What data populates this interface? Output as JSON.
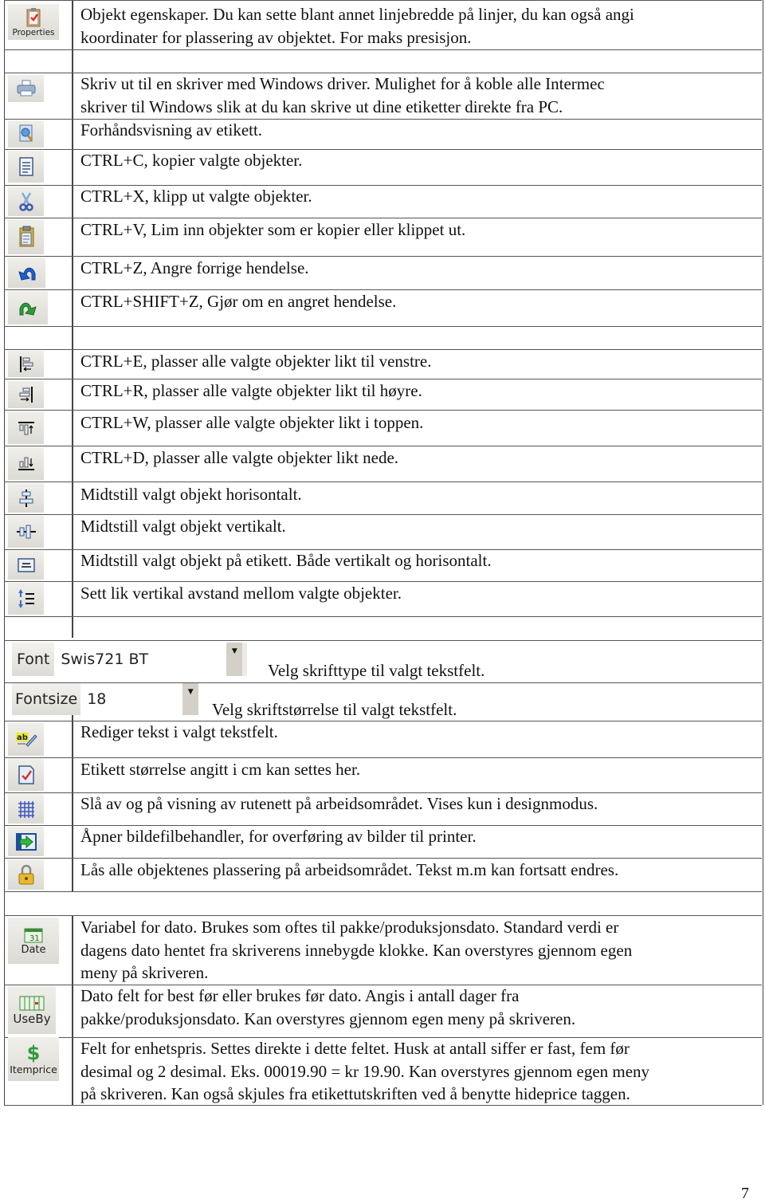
{
  "rows": {
    "properties": {
      "button_label": "Properties",
      "text": [
        "Objekt egenskaper. Du kan sette blant annet linjebredde på linjer, du kan også angi",
        "koordinater for plassering av objektet. For maks presisjon."
      ]
    },
    "print": {
      "text": [
        "Skriv ut til en skriver med Windows driver. Mulighet for å koble alle Intermec",
        "skriver til Windows slik at du kan skrive ut dine etiketter direkte fra PC."
      ]
    },
    "preview": {
      "text": "Forhåndsvisning av etikett."
    },
    "copy": {
      "text": "CTRL+C, kopier valgte objekter."
    },
    "cut": {
      "text": "CTRL+X, klipp ut valgte objekter."
    },
    "paste": {
      "text": "CTRL+V, Lim inn objekter som er kopier eller klippet ut."
    },
    "undo": {
      "text": "CTRL+Z, Angre forrige hendelse."
    },
    "redo": {
      "text": "CTRL+SHIFT+Z, Gjør om en angret hendelse."
    },
    "align_left": {
      "text": "CTRL+E, plasser alle valgte objekter likt til venstre."
    },
    "align_right": {
      "text": "CTRL+R, plasser alle valgte objekter likt til høyre."
    },
    "align_top": {
      "text": "CTRL+W, plasser alle valgte objekter likt i toppen."
    },
    "align_bottom": {
      "text": "CTRL+D, plasser alle valgte objekter likt nede."
    },
    "center_h": {
      "text": "Midtstill valgt objekt horisontalt."
    },
    "center_v": {
      "text": "Midtstill valgt objekt vertikalt."
    },
    "center_label": {
      "text": "Midtstill valgt objekt på etikett. Både vertikalt og horisontalt."
    },
    "equal_spacing": {
      "text": "Sett lik vertikal avstand mellom valgte objekter."
    },
    "font": {
      "label": "Font",
      "value": "Swis721 BT",
      "text": "Velg skrifttype til valgt tekstfelt."
    },
    "fontsize": {
      "label": "Fontsize",
      "value": "18",
      "text": "Velg skriftstørrelse til valgt tekstfelt."
    },
    "edit_text": {
      "text": "Rediger tekst i valgt tekstfelt."
    },
    "label_size": {
      "text": "Etikett størrelse angitt i cm kan settes her."
    },
    "grid": {
      "text": "Slå av og på visning av rutenett på arbeidsområdet. Vises kun i designmodus."
    },
    "image_manager": {
      "text": "Åpner bildefilbehandler, for overføring av bilder til printer."
    },
    "lock": {
      "text": "Lås alle objektenes plassering på arbeidsområdet. Tekst m.m kan fortsatt endres."
    },
    "date": {
      "button_label": "Date",
      "calendar_day": "31",
      "text": [
        "Variabel for dato. Brukes som oftes til pakke/produksjonsdato. Standard verdi er",
        "dagens dato hentet fra skriverens innebygde klokke. Kan overstyres gjennom egen",
        "meny på skriveren."
      ]
    },
    "useby": {
      "button_label": "UseBy",
      "text": [
        "Dato felt for best før eller brukes før dato. Angis i antall dager fra",
        "pakke/produksjonsdato. Kan overstyres gjennom egen meny på skriveren."
      ]
    },
    "itemprice": {
      "button_label": "Itemprice",
      "symbol": "$",
      "text": [
        "Felt for enhetspris. Settes direkte i dette feltet. Husk at antall siffer er fast, fem før",
        "desimal og 2 desimal. Eks. 00019.90 = kr 19.90. Kan overstyres gjennom egen meny",
        "på skriveren. Kan også skjules fra etikettutskriften ved å benytte hideprice taggen."
      ]
    }
  },
  "page_number": "7",
  "colors": {
    "icon_blue": "#3a6fc4",
    "icon_green": "#2f9a3a",
    "icon_red": "#d8322b",
    "lock_gold": "#d9a520",
    "button_bg": "#e4e2dc"
  }
}
